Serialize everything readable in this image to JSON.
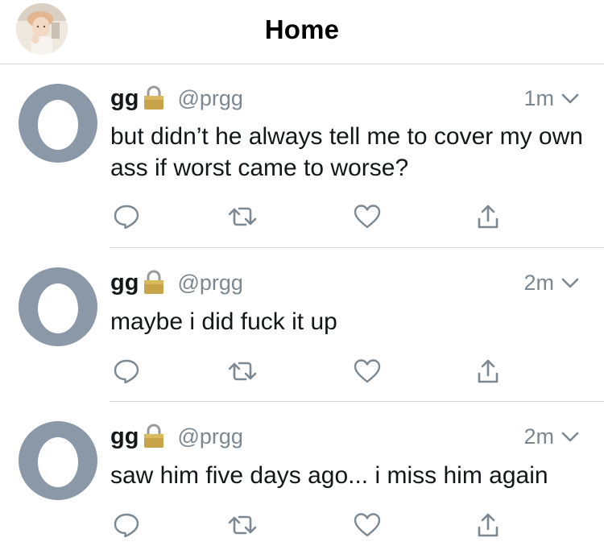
{
  "header": {
    "title": "Home",
    "avatar_label": "profile-photo"
  },
  "tweets": [
    {
      "name": "gg",
      "handle": "@prgg",
      "time": "1m",
      "text": "but didn’t he always tell me to cover my own ass if worst came to worse?"
    },
    {
      "name": "gg",
      "handle": "@prgg",
      "time": "2m",
      "text": "maybe i did fuck it up"
    },
    {
      "name": "gg",
      "handle": "@prgg",
      "time": "2m",
      "text": "saw him five days ago... i miss him again"
    }
  ],
  "icons": {
    "protected": "lock-icon",
    "caret": "chevron-down-icon",
    "reply": "reply-icon",
    "retweet": "retweet-icon",
    "like": "heart-icon",
    "share": "share-icon"
  },
  "colors": {
    "egg_background": "#8b98a7",
    "secondary_text": "#7b8791",
    "divider": "#d4d7da",
    "icon": "#7b8791"
  }
}
